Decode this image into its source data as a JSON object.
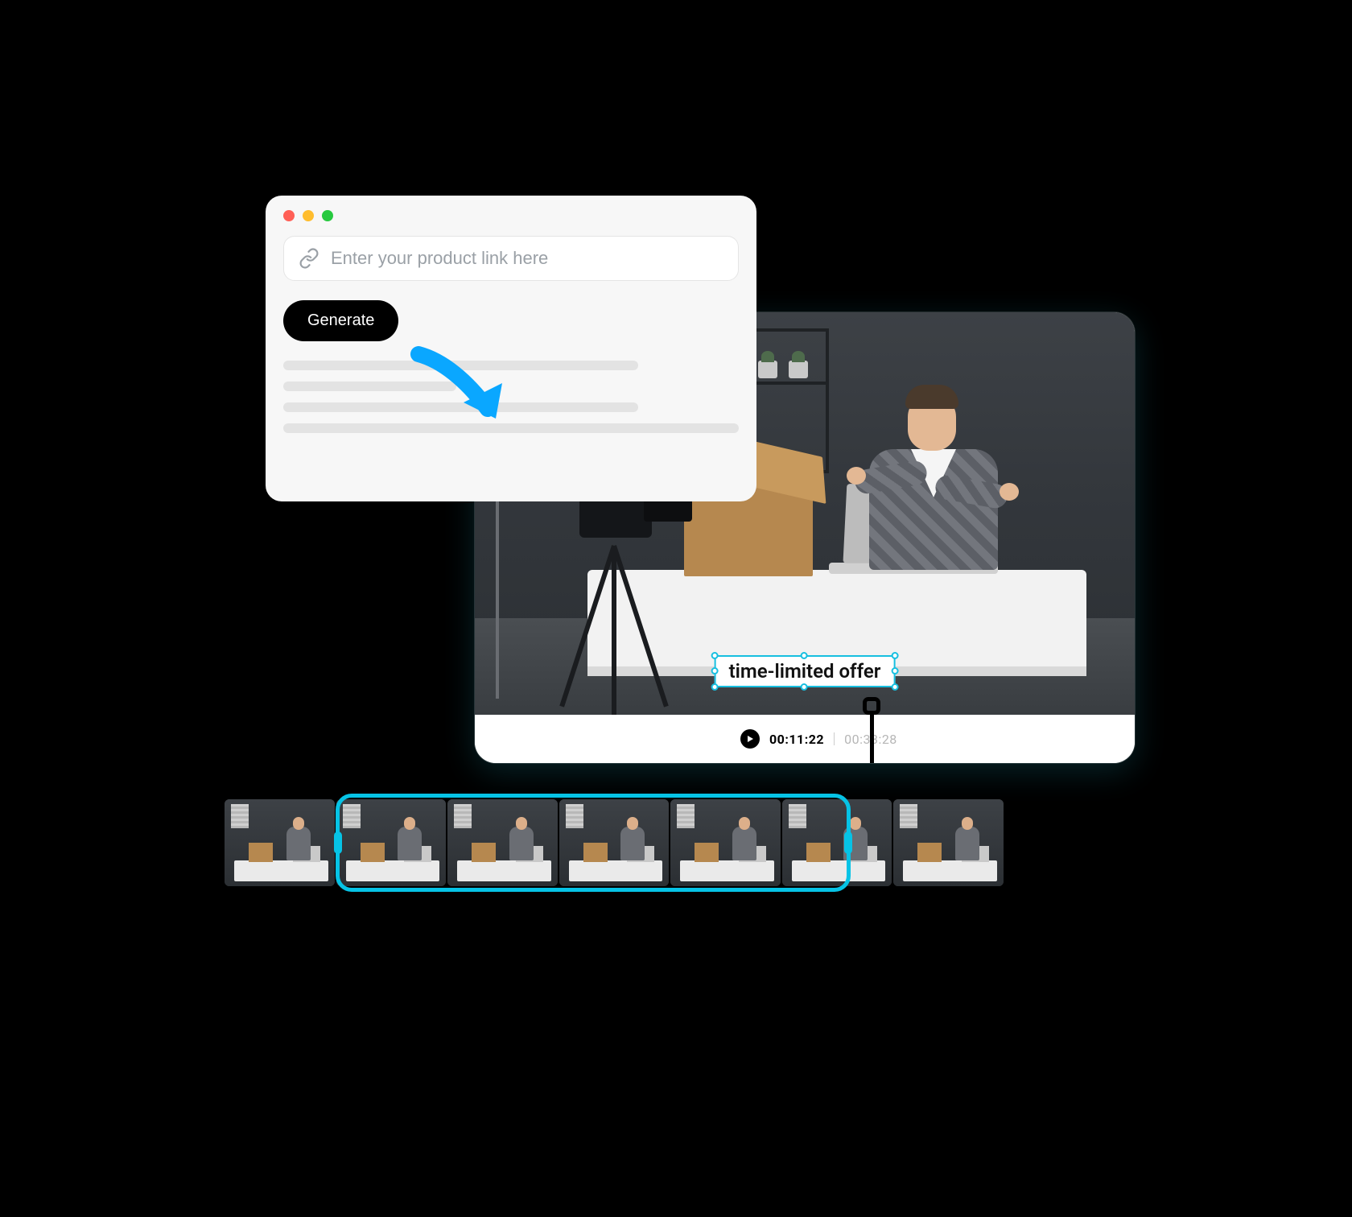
{
  "input_panel": {
    "placeholder": "Enter your product link here",
    "generate_label": "Generate"
  },
  "video": {
    "caption_text": "time-limited offer",
    "time_current": "00:11:22",
    "time_total": "00:33:28"
  },
  "colors": {
    "accent": "#06c3e6",
    "arrow": "#0aa7ff"
  },
  "timeline": {
    "clip_count": 7,
    "selection_start_index": 1,
    "selection_end_index": 5
  }
}
